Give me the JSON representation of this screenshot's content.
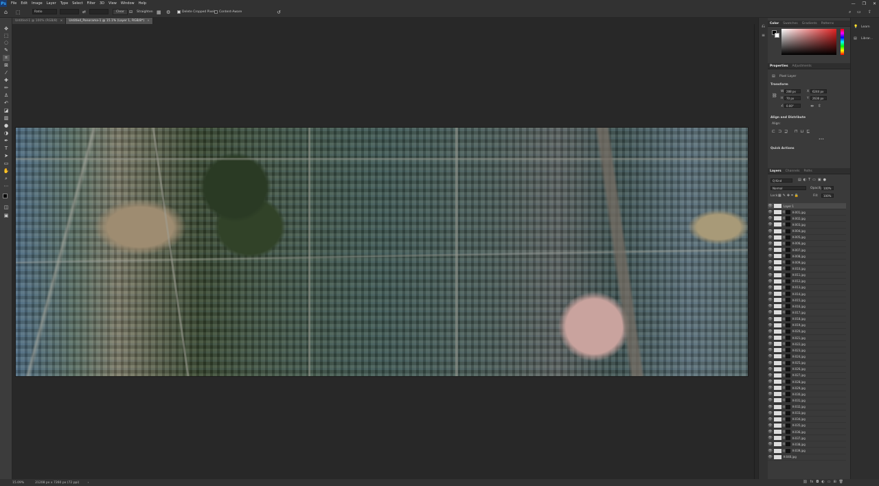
{
  "app": {
    "logo": "Ps",
    "window_controls": [
      "—",
      "❐",
      "✕"
    ]
  },
  "menu": [
    "File",
    "Edit",
    "Image",
    "Layer",
    "Type",
    "Select",
    "Filter",
    "3D",
    "View",
    "Window",
    "Help"
  ],
  "options_bar": {
    "ratio_value": "Ratio",
    "clear_label": "Clear",
    "straighten_label": "Straighten",
    "delete_cropped_label": "Delete Cropped Pixels",
    "delete_cropped_checked": true,
    "content_aware_label": "Content-Aware",
    "content_aware_checked": false
  },
  "tabs": [
    {
      "label": "Untitled-1 @ 100% (RGB/8)",
      "close": "×",
      "active": false
    },
    {
      "label": "Untitled_Panorama-1 @ 15.1% (Layer 1, RGB/8*)",
      "close": "×",
      "active": true
    }
  ],
  "status": {
    "zoom": "15.09%",
    "doc_size": "21208 px x 7260 px (72 ppi)",
    "arrow": "›"
  },
  "right_strip": {
    "learn_label": "Learn",
    "libraries_label": "Librar..."
  },
  "color_panel": {
    "tabs": [
      "Color",
      "Swatches",
      "Gradients",
      "Patterns"
    ],
    "active": "Color",
    "foreground": "#000000",
    "background": "#ffffff"
  },
  "properties": {
    "tabs": [
      "Properties",
      "Adjustments"
    ],
    "active": "Properties",
    "layer_kind": "Pixel Layer",
    "transform_title": "Transform",
    "w_label": "W",
    "w_value": "288 px",
    "h_label": "H",
    "h_value": "70 px",
    "x_label": "X",
    "x_value": "6244 px",
    "y_label": "Y",
    "y_value": "2636 px",
    "angle_value": "0.00°",
    "align_title": "Align and Distribute",
    "align_label": "Align:",
    "more_label": "•••",
    "quick_actions_title": "Quick Actions"
  },
  "layers_panel": {
    "tabs": [
      "Layers",
      "Channels",
      "Paths"
    ],
    "active": "Layers",
    "filter_kind": "Q Kind",
    "blend_mode": "Normal",
    "opacity_label": "Opacity:",
    "opacity_value": "100%",
    "lock_label": "Lock:",
    "fill_label": "Fill:",
    "fill_value": "100%",
    "layers": [
      "Layer 1",
      "K-001.jpg",
      "K-002.jpg",
      "K-003.jpg",
      "K-004.jpg",
      "K-005.jpg",
      "K-006.jpg",
      "K-007.jpg",
      "K-008.jpg",
      "K-009.jpg",
      "K-010.jpg",
      "K-011.jpg",
      "K-012.jpg",
      "K-013.jpg",
      "K-014.jpg",
      "K-015.jpg",
      "K-016.jpg",
      "K-017.jpg",
      "K-018.jpg",
      "K-019.jpg",
      "K-020.jpg",
      "K-021.jpg",
      "K-022.jpg",
      "K-023.jpg",
      "K-024.jpg",
      "K-025.jpg",
      "K-026.jpg",
      "K-027.jpg",
      "K-028.jpg",
      "K-029.jpg",
      "K-030.jpg",
      "K-031.jpg",
      "K-032.jpg",
      "K-033.jpg",
      "K-034.jpg",
      "K-035.jpg",
      "K-036.jpg",
      "K-037.jpg",
      "K-038.jpg",
      "K-039.jpg",
      "K-040.jpg"
    ],
    "selected_layer": "Layer 1",
    "bottom_icons": [
      "link-icon",
      "fx-icon",
      "mask-icon",
      "adjustment-icon",
      "folder-icon",
      "new-layer-icon",
      "trash-icon"
    ]
  },
  "tools": [
    "move-icon",
    "marquee-icon",
    "lasso-icon",
    "quick-select-icon",
    "crop-icon",
    "frame-icon",
    "eyedropper-icon",
    "healing-icon",
    "brush-icon",
    "clone-stamp-icon",
    "history-brush-icon",
    "eraser-icon",
    "gradient-icon",
    "blur-icon",
    "dodge-icon",
    "pen-icon",
    "type-icon",
    "path-select-icon",
    "rectangle-icon",
    "hand-icon",
    "zoom-icon",
    "more-tools-icon"
  ]
}
